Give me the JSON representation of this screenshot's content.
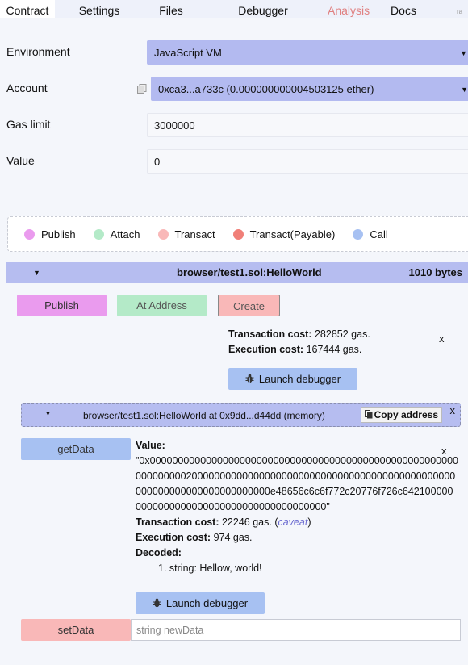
{
  "tabs": [
    {
      "label": "Contract"
    },
    {
      "label": "Settings"
    },
    {
      "label": "Files"
    },
    {
      "label": "Debugger"
    },
    {
      "label": "Analysis"
    },
    {
      "label": "Docs"
    }
  ],
  "tabs_more": "ra",
  "form": {
    "environment_label": "Environment",
    "environment_value": "JavaScript VM",
    "account_label": "Account",
    "account_value": "0xca3...a733c (0.000000000004503125 ether)",
    "gas_limit_label": "Gas limit",
    "gas_limit_value": "3000000",
    "value_label": "Value",
    "value_value": "0"
  },
  "legend": [
    {
      "label": "Publish",
      "color": "#ea9bee"
    },
    {
      "label": "Attach",
      "color": "#b4eac8"
    },
    {
      "label": "Transact",
      "color": "#f9b8b8"
    },
    {
      "label": "Transact(Payable)",
      "color": "#f07f78"
    },
    {
      "label": "Call",
      "color": "#a7c1f2"
    }
  ],
  "contract": {
    "name": "browser/test1.sol:HelloWorld",
    "size": "1010 bytes",
    "publish_label": "Publish",
    "at_address_label": "At Address",
    "create_label": "Create",
    "tx_cost_label": "Transaction cost:",
    "tx_cost_value": "282852 gas.",
    "exec_cost_label": "Execution cost:",
    "exec_cost_value": "167444 gas.",
    "close_label": "x",
    "launch_debugger_label": "Launch debugger"
  },
  "instance": {
    "title": "browser/test1.sol:HelloWorld at 0x9dd...d44dd (memory)",
    "copy_label": "Copy address",
    "close_label": "x",
    "get_label": "getData",
    "value_label": "Value:",
    "value_hex": "\"0x0000000000000000000000000000000000000000000000000000000000000000200000000000000000000000000000000000000000000000000000000000000000000000e48656c6c6f772c20776f726c6421000000000000000000000000000000000000000\"",
    "tx_cost_label": "Transaction cost:",
    "tx_cost_value": "22246 gas.",
    "caveat_label": "caveat",
    "exec_cost_label": "Execution cost:",
    "exec_cost_value": "974 gas.",
    "decoded_label": "Decoded:",
    "decoded_items": [
      "string: Hellow, world!"
    ],
    "result_close_label": "x",
    "launch_debugger_label": "Launch debugger",
    "set_label": "setData",
    "set_placeholder": "string newData"
  }
}
